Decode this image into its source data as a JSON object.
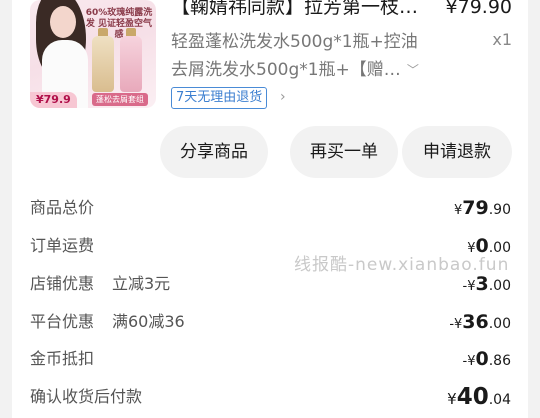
{
  "product": {
    "title": "【鞠婧祎同款】拉芳第一枝…",
    "price": "¥79.90",
    "spec_line1": "轻盈蓬松洗发水500g*1瓶+控油",
    "spec_line2": "去屑洗发水500g*1瓶+【赠…",
    "quantity": "x1",
    "badge": "7天无理由退货",
    "thumb_headline": "60%玫瑰纯露洗发 见证轻盈空气感",
    "thumb_price": "79.9",
    "thumb_set": "蓬松去屑套组"
  },
  "actions": {
    "share": "分享商品",
    "rebuy": "再买一单",
    "refund": "申请退款"
  },
  "summary": [
    {
      "label": "商品总价",
      "sub": "",
      "sym": "¥",
      "int": "79",
      "dec": ".90"
    },
    {
      "label": "订单运费",
      "sub": "",
      "sym": "¥",
      "int": "0",
      "dec": ".00"
    },
    {
      "label": "店铺优惠",
      "sub": "立减3元",
      "sym": "-¥",
      "int": "3",
      "dec": ".00"
    },
    {
      "label": "平台优惠",
      "sub": "满60减36",
      "sym": "-¥",
      "int": "36",
      "dec": ".00"
    },
    {
      "label": "金币抵扣",
      "sub": "",
      "sym": "-¥",
      "int": "0",
      "dec": ".86"
    },
    {
      "label": "确认收货后付款",
      "sub": "",
      "sym": "¥",
      "int": "40",
      "dec": ".04"
    }
  ],
  "watermark": "线报酷-new.xianbao.fun"
}
